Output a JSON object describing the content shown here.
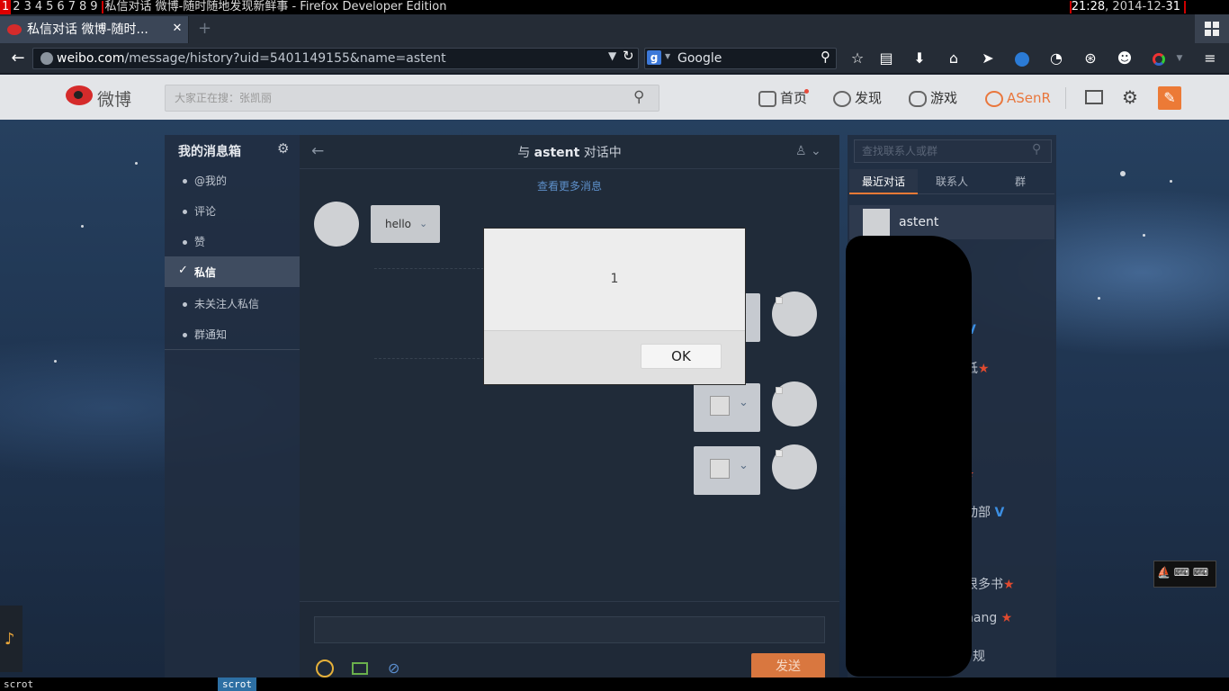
{
  "wm": {
    "workspaces": [
      "1",
      "2",
      "3",
      "4",
      "5",
      "6",
      "7",
      "8",
      "9"
    ],
    "active_workspace": "1",
    "window_title": "私信对话 微博-随时随地发现新鲜事 - Firefox Developer Edition",
    "clock_time": "21:28",
    "clock_date_prefix": ", 2014-12-",
    "clock_day": "31"
  },
  "browser": {
    "tab_title": "私信对话 微博-随时...",
    "url_host": "weibo.com",
    "url_path": "/message/history?uid=5401149155&name=astent",
    "search_engine": "Google",
    "search_engine_icon": "g",
    "icons": [
      "back-arrow",
      "globe",
      "dropdown",
      "reload",
      "search",
      "star",
      "clipboard",
      "download",
      "home",
      "send",
      "eye-addon",
      "history-addon",
      "stamp-addon",
      "chat-addon",
      "color-addon",
      "menu"
    ]
  },
  "weibo": {
    "logo_text": "微博",
    "search_placeholder": "大家正在搜：张凯丽",
    "nav": {
      "home": "首页",
      "discover": "发现",
      "games": "游戏",
      "user": "ASenR"
    },
    "colors": {
      "accent": "#ec7a36",
      "brand_red": "#d52b2b"
    }
  },
  "sidebar": {
    "title": "我的消息箱",
    "items": [
      {
        "label": "@我的"
      },
      {
        "label": "评论"
      },
      {
        "label": "赞"
      },
      {
        "label": "私信",
        "active": true
      },
      {
        "label": "未关注人私信"
      },
      {
        "label": "群通知"
      }
    ]
  },
  "chat": {
    "title_prefix": "与 ",
    "title_name": "astent",
    "title_suffix": " 对话中",
    "more_link": "查看更多消息",
    "message_hello": "hello",
    "send_label": "发送"
  },
  "contacts": {
    "search_placeholder": "查找联系人或群",
    "tabs": [
      "最近对话",
      "联系人",
      "群"
    ],
    "active_contact": "astent",
    "fragments": [
      "抵",
      "动部",
      "很多书",
      "hang",
      "规"
    ]
  },
  "alert": {
    "message": "1",
    "ok_label": "OK"
  },
  "bottom": {
    "command": "scrot",
    "task": "scrot"
  }
}
